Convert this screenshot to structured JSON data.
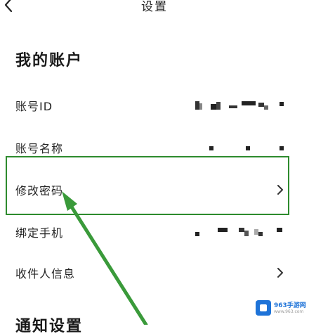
{
  "header": {
    "title": "设置"
  },
  "account_section": {
    "title": "我的账户",
    "rows": [
      {
        "label": "账号ID",
        "value": "masked"
      },
      {
        "label": "账号名称",
        "value": "masked"
      },
      {
        "label": "修改密码",
        "value": ""
      },
      {
        "label": "绑定手机",
        "value": "masked"
      },
      {
        "label": "收件人信息",
        "value": ""
      }
    ]
  },
  "notification_section": {
    "title": "通知设置"
  },
  "watermark": {
    "name": "963手游网",
    "url": "www.963.com"
  },
  "colors": {
    "highlight": "#2e8b2e",
    "arrow": "#3a9a3a"
  },
  "icons": {
    "back": "chevron-left-icon",
    "row_action": "chevron-right-icon"
  }
}
